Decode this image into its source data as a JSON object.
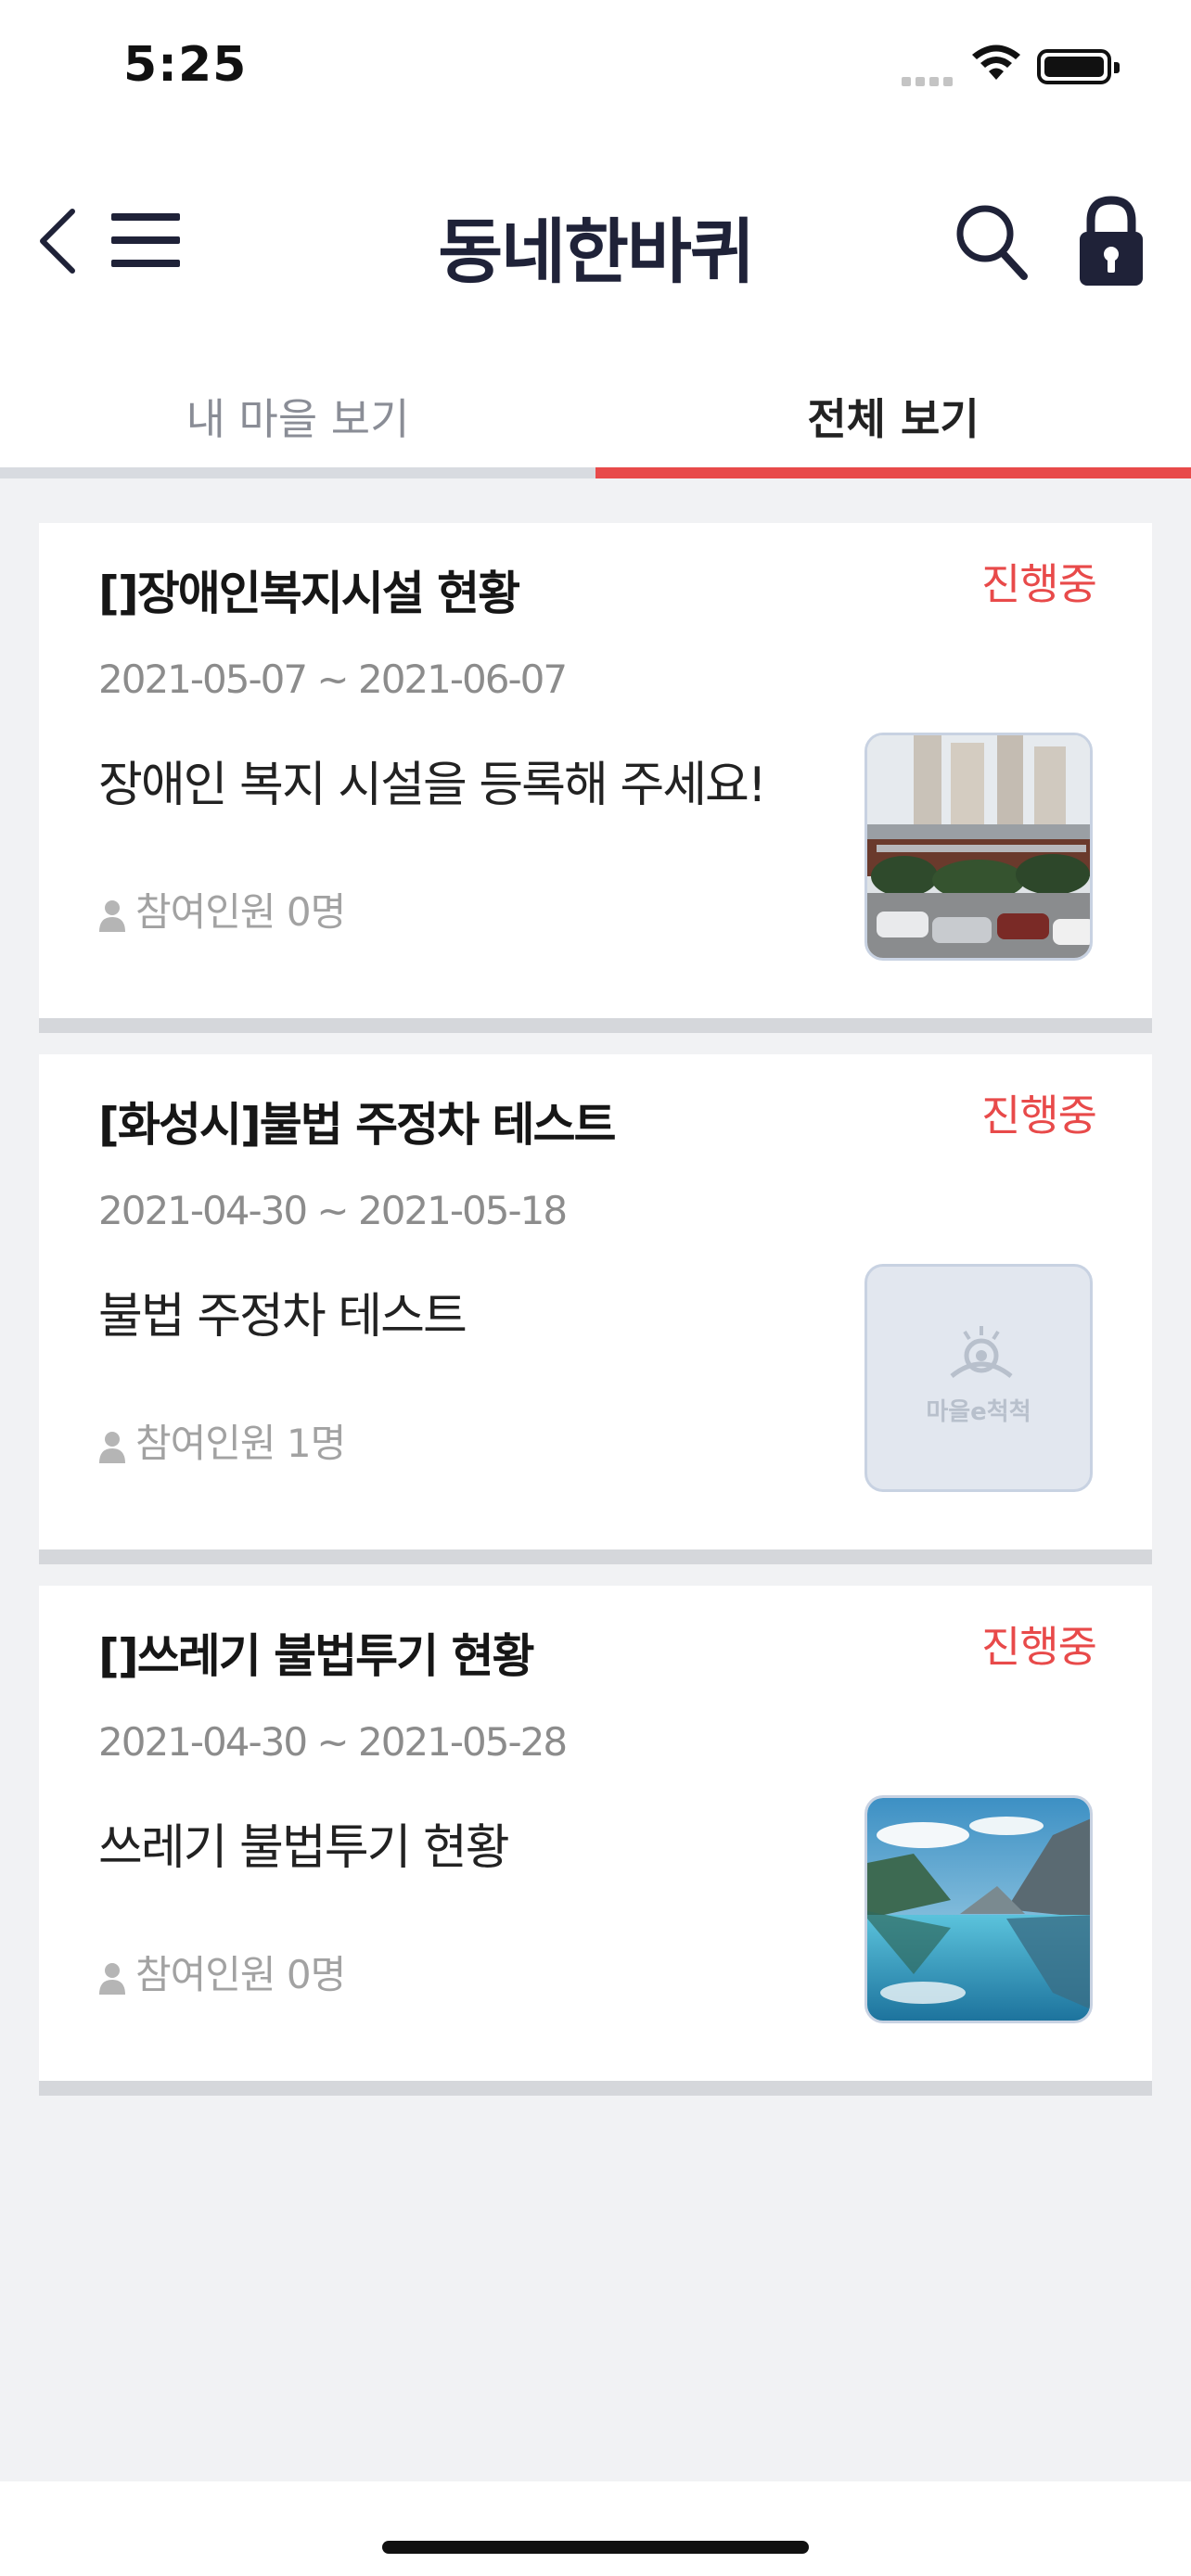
{
  "status_bar": {
    "time": "5:25"
  },
  "nav": {
    "title": "동네한바퀴",
    "back_icon": "chevron-left-icon",
    "menu_icon": "hamburger-icon",
    "search_icon": "search-icon",
    "lock_icon": "lock-icon"
  },
  "tabs": [
    {
      "label": "내 마을 보기",
      "active": false
    },
    {
      "label": "전체 보기",
      "active": true
    }
  ],
  "colors": {
    "accent": "#e84a4a",
    "title": "#1f2238",
    "background": "#f1f2f4"
  },
  "cards": [
    {
      "title": "[]장애인복지시설 현황",
      "status": "진행중",
      "date": "2021-05-07 ~ 2021-06-07",
      "description": "장애인 복지 시설을 등록해 주세요!",
      "participants": "참여인원 0명",
      "thumbnail": "building-photo"
    },
    {
      "title": "[화성시]불법 주정차 테스트",
      "status": "진행중",
      "date": "2021-04-30 ~ 2021-05-18",
      "description": "불법 주정차 테스트",
      "participants": "참여인원 1명",
      "thumbnail": "placeholder-logo",
      "placeholder_text": "마을e척척"
    },
    {
      "title": "[]쓰레기 불법투기 현황",
      "status": "진행중",
      "date": "2021-04-30 ~ 2021-05-28",
      "description": "쓰레기 불법투기 현황",
      "participants": "참여인원 0명",
      "thumbnail": "lake-photo"
    }
  ]
}
